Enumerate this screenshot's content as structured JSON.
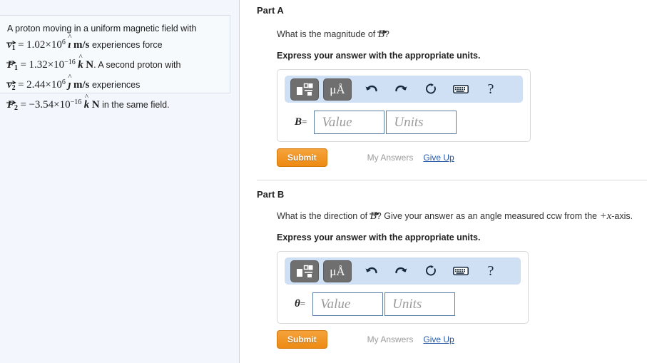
{
  "problem": {
    "line1_pre": "A proton moving in a uniform magnetic field with",
    "v1": {
      "sym": "v",
      "sub": "1",
      "eq": "=",
      "coef": "1.02",
      "times": "×",
      "base": "10",
      "exp": "6",
      "hat": "ı",
      "unit": "m/s",
      "tail": "experiences force"
    },
    "f1": {
      "sym": "F",
      "sub": "1",
      "eq": "=",
      "coef": "1.32",
      "times": "×",
      "base": "10",
      "exp": "−16",
      "hat": "k",
      "unit": "N",
      "tail": ". A second proton with"
    },
    "v2": {
      "sym": "v",
      "sub": "2",
      "eq": "=",
      "coef": "2.44",
      "times": "×",
      "base": "10",
      "exp": "6",
      "hat": "ȷ",
      "unit": "m/s",
      "tail": "experiences"
    },
    "f2": {
      "sym": "F",
      "sub": "2",
      "eq": "=",
      "coef": "−3.54",
      "times": "×",
      "base": "10",
      "exp": "−16",
      "hat": "k",
      "unit": "N",
      "tail": "in the same field."
    }
  },
  "part_a": {
    "heading": "Part A",
    "question_pre": "What is the magnitude of ",
    "question_sym": "B",
    "question_post": "?",
    "instruction": "Express your answer with the appropriate units.",
    "var_label": "B",
    "equals": "=",
    "value_placeholder": "Value",
    "units_placeholder": "Units",
    "value": "",
    "units": "",
    "submit_label": "Submit",
    "my_answers_label": "My Answers",
    "give_up_label": "Give Up"
  },
  "part_b": {
    "heading": "Part B",
    "question_pre": "What is the direction of ",
    "question_sym": "B",
    "question_mid": "? Give your answer as an angle measured ccw from the ",
    "question_axis": "+x",
    "question_post": "-axis.",
    "instruction": "Express your answer with the appropriate units.",
    "var_label": "θ",
    "equals": "=",
    "value_placeholder": "Value",
    "units_placeholder": "Units",
    "value": "",
    "units": "",
    "submit_label": "Submit",
    "my_answers_label": "My Answers",
    "give_up_label": "Give Up"
  },
  "toolbar": {
    "template_icon": "template-layout-icon",
    "units_icon_label": "μÅ",
    "undo_icon": "undo-icon",
    "redo_icon": "redo-icon",
    "reset_icon": "reset-icon",
    "keyboard_icon": "keyboard-icon",
    "help_label": "?"
  },
  "colors": {
    "toolbar_bg": "#cfe0f5",
    "submit_orange": "#ed8b13",
    "link_blue": "#2659a8",
    "panel_bg": "#f3f7fd",
    "input_border": "#5b7fa6"
  }
}
